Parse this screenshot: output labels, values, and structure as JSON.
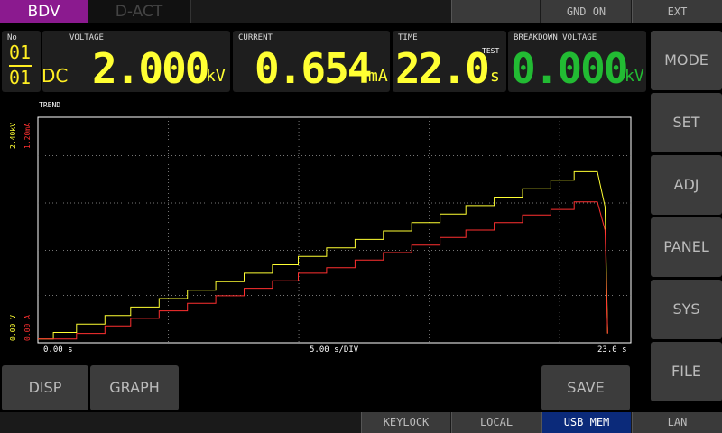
{
  "tabs": {
    "bdv": "BDV",
    "dact": "D-ACT"
  },
  "top_buttons": {
    "gnd": "GND ON",
    "ext": "EXT"
  },
  "readouts": {
    "no_label": "No",
    "no_top": "01",
    "no_bottom": "01",
    "mode": "DC",
    "voltage_label": "VOLTAGE",
    "voltage_value": "2.000",
    "voltage_unit": "kV",
    "current_label": "CURRENT",
    "current_value": "0.654",
    "current_unit": "mA",
    "time_label": "TIME",
    "time_value": "22.0",
    "time_sup": "TEST",
    "time_unit": "s",
    "bdv_label": "BREAKDOWN VOLTAGE",
    "bdv_value": "0.000",
    "bdv_unit": "kV"
  },
  "side_buttons": [
    "MODE",
    "SET",
    "ADJ",
    "PANEL",
    "SYS",
    "FILE"
  ],
  "trend": {
    "title": "TREND",
    "y_top_voltage": "2.40kV",
    "y_top_current": "1.20mA",
    "y_bottom_voltage": "0.00 V",
    "y_bottom_current": "0.00 A",
    "x_start": "0.00 s",
    "x_div": "5.00 s/DIV",
    "x_end": "23.0 s"
  },
  "bottom_buttons": {
    "disp": "DISP",
    "graph": "GRAPH",
    "save": "SAVE"
  },
  "status": {
    "keylock": "KEYLOCK",
    "local": "LOCAL",
    "usb": "USB MEM",
    "lan": "LAN"
  },
  "colors": {
    "voltage": "#ffff33",
    "current": "#ff3030",
    "bdv": "#22bb33",
    "accent": "#8b1a8f",
    "active": "#0b2a7a"
  },
  "chart_data": {
    "type": "line",
    "x_range": [
      0,
      23
    ],
    "series": [
      {
        "color": "#ffff33",
        "unit": "kV",
        "y_range": [
          0,
          2.4
        ],
        "x": [
          0,
          0.6,
          0.6,
          1.5,
          1.5,
          2.6,
          2.6,
          3.6,
          3.6,
          4.7,
          4.7,
          5.8,
          5.8,
          6.9,
          6.9,
          8.0,
          8.0,
          9.1,
          9.1,
          10.1,
          10.1,
          11.2,
          11.2,
          12.3,
          12.3,
          13.4,
          13.4,
          14.5,
          14.5,
          15.6,
          15.6,
          16.6,
          16.6,
          17.7,
          17.7,
          18.8,
          18.8,
          19.9,
          19.9,
          20.8,
          20.8,
          21.7,
          22.0,
          22.1
        ],
        "y": [
          0.04,
          0.04,
          0.11,
          0.11,
          0.2,
          0.2,
          0.29,
          0.29,
          0.38,
          0.38,
          0.47,
          0.47,
          0.56,
          0.56,
          0.65,
          0.65,
          0.74,
          0.74,
          0.83,
          0.83,
          0.92,
          0.92,
          1.01,
          1.01,
          1.1,
          1.1,
          1.19,
          1.19,
          1.28,
          1.28,
          1.37,
          1.37,
          1.46,
          1.46,
          1.55,
          1.55,
          1.64,
          1.64,
          1.73,
          1.73,
          1.82,
          1.82,
          1.45,
          0.1
        ]
      },
      {
        "color": "#ff3030",
        "unit": "mA",
        "y_range": [
          0,
          1.2
        ],
        "x": [
          0,
          1.5,
          1.5,
          2.6,
          2.6,
          3.6,
          3.6,
          4.7,
          4.7,
          5.8,
          5.8,
          6.9,
          6.9,
          8.0,
          8.0,
          9.1,
          9.1,
          10.1,
          10.1,
          11.2,
          11.2,
          12.3,
          12.3,
          13.4,
          13.4,
          14.5,
          14.5,
          15.6,
          15.6,
          16.6,
          16.6,
          17.7,
          17.7,
          18.8,
          18.8,
          19.9,
          19.9,
          20.8,
          20.8,
          21.7,
          22.0,
          22.1
        ],
        "y": [
          0.02,
          0.02,
          0.05,
          0.05,
          0.09,
          0.09,
          0.13,
          0.13,
          0.17,
          0.17,
          0.21,
          0.21,
          0.25,
          0.25,
          0.29,
          0.29,
          0.33,
          0.33,
          0.37,
          0.37,
          0.4,
          0.4,
          0.44,
          0.44,
          0.48,
          0.48,
          0.52,
          0.52,
          0.56,
          0.56,
          0.6,
          0.6,
          0.64,
          0.64,
          0.68,
          0.68,
          0.71,
          0.71,
          0.75,
          0.75,
          0.6,
          0.05
        ]
      }
    ]
  }
}
